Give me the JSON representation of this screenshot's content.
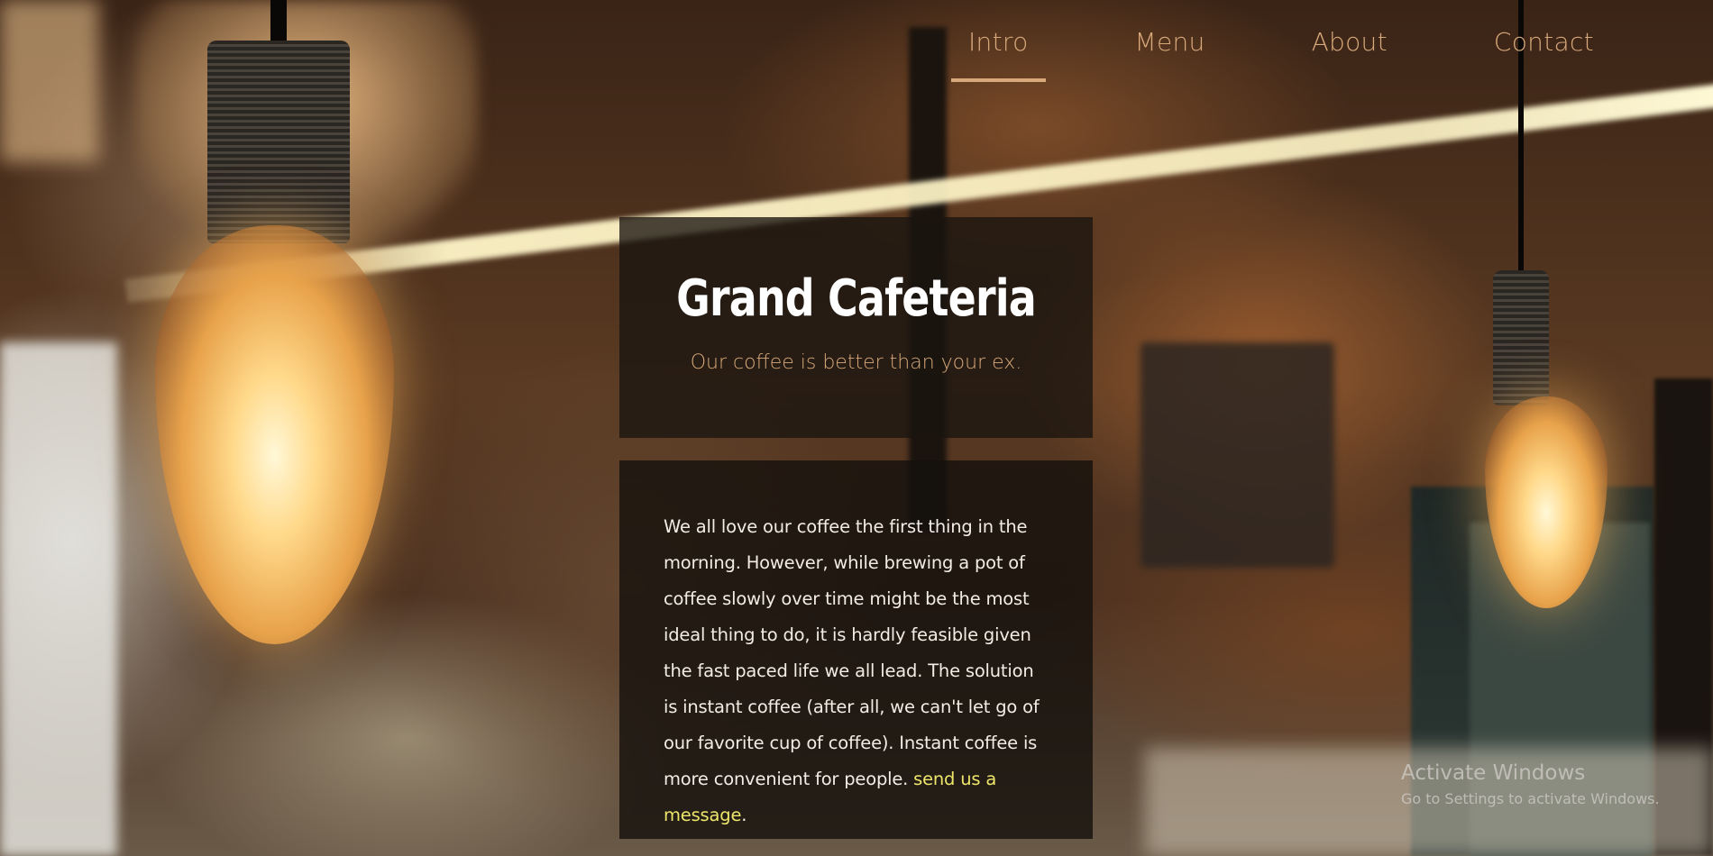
{
  "nav": {
    "items": [
      {
        "label": "Intro",
        "active": true
      },
      {
        "label": "Menu"
      },
      {
        "label": "About"
      },
      {
        "label": "Contact"
      }
    ]
  },
  "hero": {
    "title": "Grand Cafeteria",
    "tagline": "Our coffee is better than your ex."
  },
  "intro": {
    "body": "We all love our coffee the first thing in the morning. However, while brewing a pot of coffee slowly over time might be the most ideal thing to do, it is hardly feasible given the fast paced life we all lead. The solution is instant coffee (after all, we can't let go of our favorite cup of coffee). Instant coffee is more convenient for people. ",
    "link_text": "send us a message",
    "after_link": "."
  },
  "watermark": {
    "title": "Activate Windows",
    "subtitle": "Go to Settings to activate Windows."
  },
  "colors": {
    "accent": "#d7a87a",
    "link": "#ede56a",
    "card": "#19140f"
  }
}
